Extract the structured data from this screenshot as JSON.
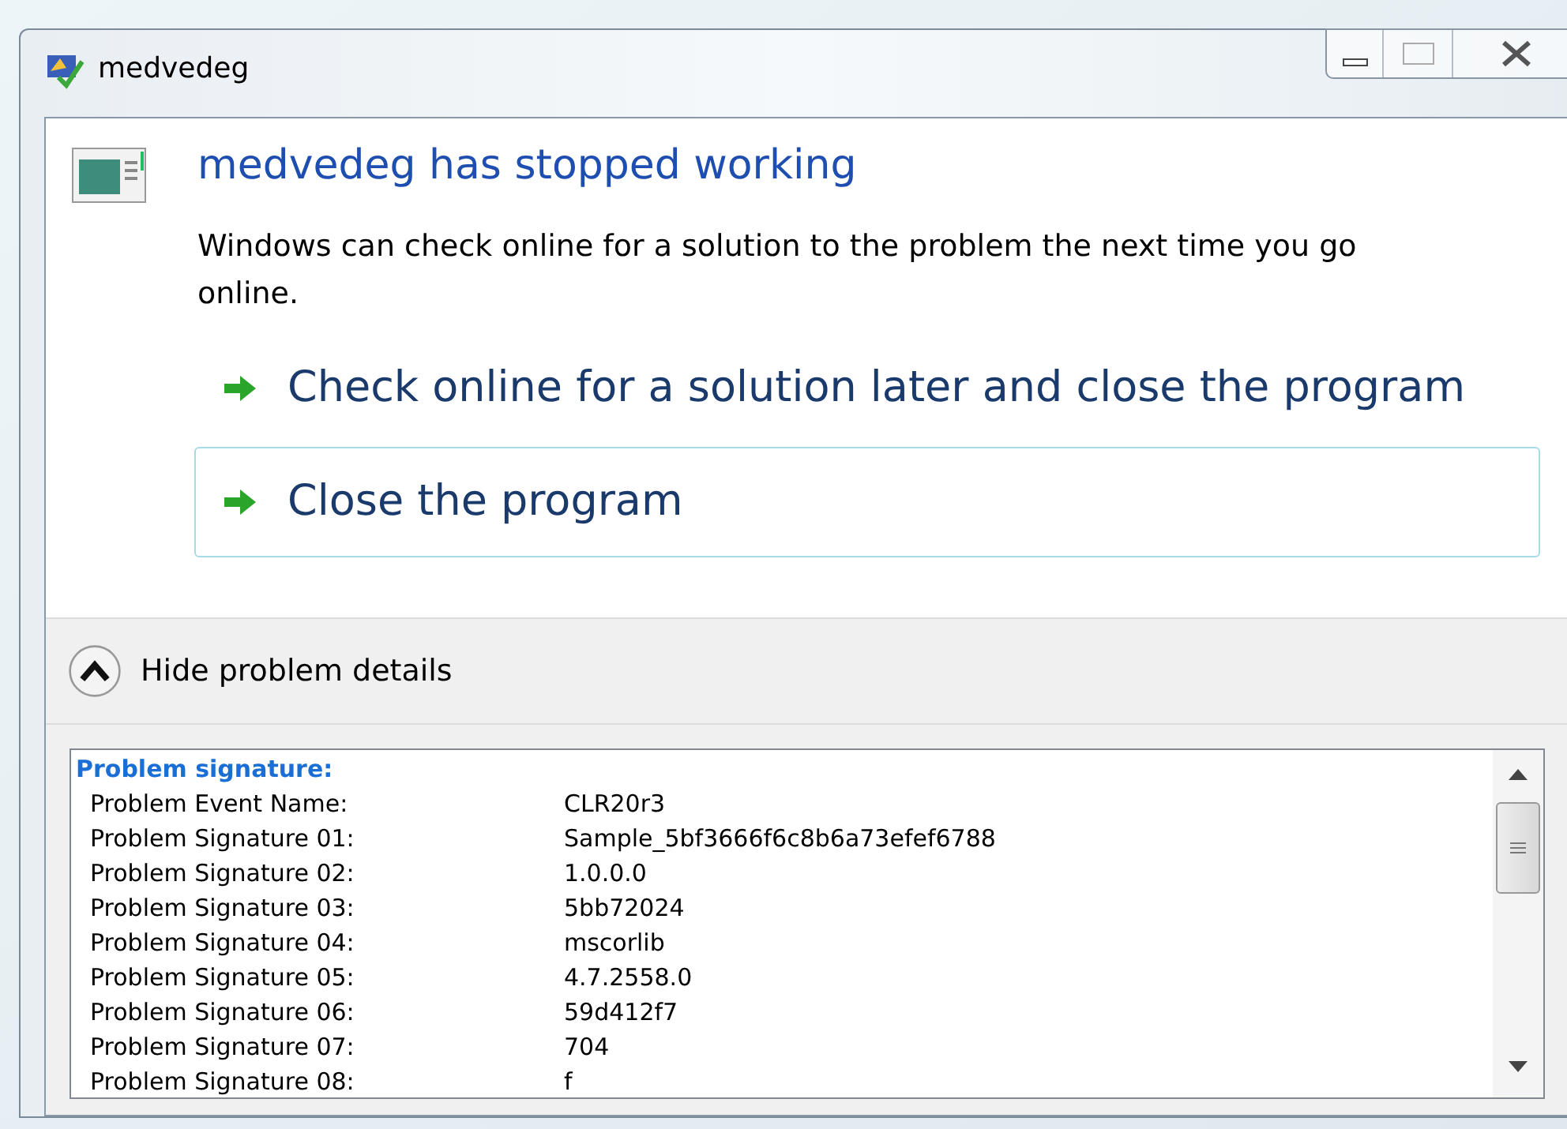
{
  "window": {
    "title": "medvedeg"
  },
  "heading": "medvedeg has stopped working",
  "message": "Windows can check online for a solution to the problem the next time you go online.",
  "commands": [
    {
      "label": "Check online for a solution later and close the program",
      "selected": false
    },
    {
      "label": "Close the program",
      "selected": true
    }
  ],
  "details_toggle": {
    "label": "Hide problem details",
    "expanded": true
  },
  "details": {
    "heading": "Problem signature:",
    "rows": [
      {
        "name": "Problem Event Name:",
        "value": "CLR20r3"
      },
      {
        "name": "Problem Signature 01:",
        "value": "Sample_5bf3666f6c8b6a73efef6788"
      },
      {
        "name": "Problem Signature 02:",
        "value": "1.0.0.0"
      },
      {
        "name": "Problem Signature 03:",
        "value": "5bb72024"
      },
      {
        "name": "Problem Signature 04:",
        "value": "mscorlib"
      },
      {
        "name": "Problem Signature 05:",
        "value": "4.7.2558.0"
      },
      {
        "name": "Problem Signature 06:",
        "value": "59d412f7"
      },
      {
        "name": "Problem Signature 07:",
        "value": "704"
      },
      {
        "name": "Problem Signature 08:",
        "value": "f"
      }
    ]
  }
}
